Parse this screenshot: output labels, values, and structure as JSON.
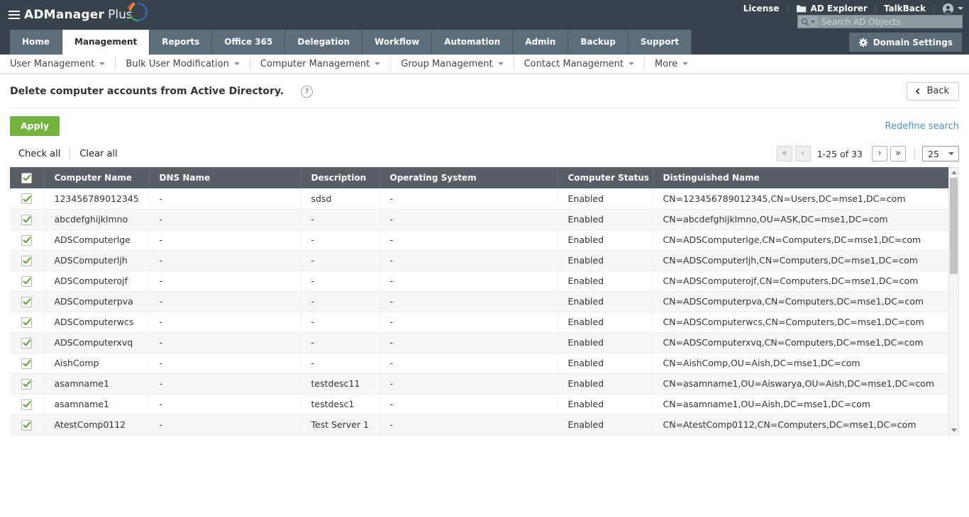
{
  "colors": {
    "header_bg": "#37424c",
    "tab_bg": "#5d6d79",
    "table_header_bg": "#575e66",
    "accent_green": "#74b33e",
    "link_blue": "#4b94cb",
    "check_green": "#56a22b"
  },
  "topbar": {
    "brand_bold": "ADManager",
    "brand_light": "Plus",
    "links": {
      "license": "License",
      "ad_explorer": "AD Explorer",
      "talkback": "TalkBack"
    },
    "search_placeholder": "Search AD Objects"
  },
  "tabs": {
    "items": [
      "Home",
      "Management",
      "Reports",
      "Office 365",
      "Delegation",
      "Workflow",
      "Automation",
      "Admin",
      "Backup",
      "Support"
    ],
    "active": "Management",
    "domain_settings_label": "Domain Settings"
  },
  "subnav": {
    "items": [
      "User Management",
      "Bulk User Modification",
      "Computer Management",
      "Group Management",
      "Contact Management",
      "More"
    ]
  },
  "page": {
    "title": "Delete computer accounts from Active Directory.",
    "help_glyph": "?",
    "back_label": "Back",
    "apply_label": "Apply",
    "redefine_label": "Redefine search",
    "check_all_label": "Check all",
    "clear_all_label": "Clear all"
  },
  "pagination": {
    "first_glyph": "«",
    "prev_glyph": "‹",
    "next_glyph": "›",
    "last_glyph": "»",
    "range_text": "1-25 of 33",
    "page_size": "25"
  },
  "table": {
    "headers": [
      "Computer Name",
      "DNS Name",
      "Description",
      "Operating System",
      "Computer Status",
      "Distinguished Name"
    ],
    "rows": [
      {
        "checked": true,
        "computer_name": "123456789012345",
        "dns_name": "-",
        "description": "sdsd",
        "os": "-",
        "status": "Enabled",
        "dn": "CN=123456789012345,CN=Users,DC=mse1,DC=com"
      },
      {
        "checked": true,
        "computer_name": "abcdefghijklmno",
        "dns_name": "-",
        "description": "-",
        "os": "-",
        "status": "Enabled",
        "dn": "CN=abcdefghijklmno,OU=ASK,DC=mse1,DC=com"
      },
      {
        "checked": true,
        "computer_name": "ADSComputerlge",
        "dns_name": "-",
        "description": "-",
        "os": "-",
        "status": "Enabled",
        "dn": "CN=ADSComputerlge,CN=Computers,DC=mse1,DC=com"
      },
      {
        "checked": true,
        "computer_name": "ADSComputerljh",
        "dns_name": "-",
        "description": "-",
        "os": "-",
        "status": "Enabled",
        "dn": "CN=ADSComputerljh,CN=Computers,DC=mse1,DC=com"
      },
      {
        "checked": true,
        "computer_name": "ADSComputerojf",
        "dns_name": "-",
        "description": "-",
        "os": "-",
        "status": "Enabled",
        "dn": "CN=ADSComputerojf,CN=Computers,DC=mse1,DC=com"
      },
      {
        "checked": true,
        "computer_name": "ADSComputerpva",
        "dns_name": "-",
        "description": "-",
        "os": "-",
        "status": "Enabled",
        "dn": "CN=ADSComputerpva,CN=Computers,DC=mse1,DC=com"
      },
      {
        "checked": true,
        "computer_name": "ADSComputerwcs",
        "dns_name": "-",
        "description": "-",
        "os": "-",
        "status": "Enabled",
        "dn": "CN=ADSComputerwcs,CN=Computers,DC=mse1,DC=com"
      },
      {
        "checked": true,
        "computer_name": "ADSComputerxvq",
        "dns_name": "-",
        "description": "-",
        "os": "-",
        "status": "Enabled",
        "dn": "CN=ADSComputerxvq,CN=Computers,DC=mse1,DC=com"
      },
      {
        "checked": true,
        "computer_name": "AishComp",
        "dns_name": "-",
        "description": "-",
        "os": "-",
        "status": "Enabled",
        "dn": "CN=AishComp,OU=Aish,DC=mse1,DC=com"
      },
      {
        "checked": true,
        "computer_name": "asamname1",
        "dns_name": "-",
        "description": "testdesc11",
        "os": "-",
        "status": "Enabled",
        "dn": "CN=asamname1,OU=Aiswarya,OU=Aish,DC=mse1,DC=com"
      },
      {
        "checked": true,
        "computer_name": "asamname1",
        "dns_name": "-",
        "description": "testdesc1",
        "os": "-",
        "status": "Enabled",
        "dn": "CN=asamname1,OU=Aish,DC=mse1,DC=com"
      },
      {
        "checked": true,
        "computer_name": "AtestComp0112",
        "dns_name": "-",
        "description": "Test Server 1",
        "os": "-",
        "status": "Enabled",
        "dn": "CN=AtestComp0112,CN=Computers,DC=mse1,DC=com"
      }
    ]
  }
}
